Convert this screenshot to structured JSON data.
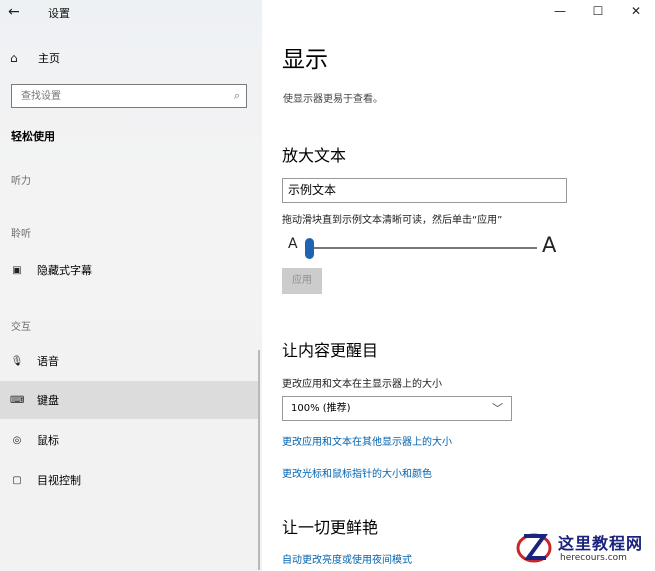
{
  "window": {
    "title": "设置",
    "back_glyph": "←",
    "minimize_glyph": "—",
    "maximize_glyph": "☐",
    "close_glyph": "✕"
  },
  "sidebar": {
    "home_label": "主页",
    "home_icon": "⌂",
    "search_placeholder": "查找设置",
    "search_icon": "⌕",
    "category_title": "轻松使用",
    "groups": {
      "hearing": "听力",
      "listening": "聆听",
      "interaction": "交互"
    },
    "items": [
      {
        "label": "隐藏式字幕",
        "icon": "▣",
        "selected": false
      },
      {
        "label": "语音",
        "icon": "🎙",
        "selected": false
      },
      {
        "label": "键盘",
        "icon": "⌨",
        "selected": true
      },
      {
        "label": "鼠标",
        "icon": "◎",
        "selected": false
      },
      {
        "label": "目视控制",
        "icon": "▢",
        "selected": false
      }
    ]
  },
  "main": {
    "title": "显示",
    "subtitle": "使显示器更易于查看。",
    "section_text": {
      "heading": "放大文本",
      "sample_text": "示例文本",
      "hint": "拖动滑块直到示例文本清晰可读，然后单击“应用”",
      "slider_min_label": "A",
      "slider_max_label": "A",
      "slider_value": 0,
      "apply_label": "应用"
    },
    "section_stand_out": {
      "heading": "让内容更醒目",
      "size_label": "更改应用和文本在主显示器上的大小",
      "size_value": "100% (推荐)",
      "size_chevron": "﹀",
      "link_other_displays": "更改应用和文本在其他显示器上的大小",
      "link_cursor": "更改光标和鼠标指针的大小和颜色"
    },
    "section_brighter": {
      "heading": "让一切更鲜艳",
      "link_brightness": "自动更改亮度或使用夜间模式"
    }
  },
  "watermark": {
    "cn": "这里教程网",
    "en": "herecours.com"
  },
  "colors": {
    "accent": "#1f64b4",
    "link": "#0063b1",
    "sidebar_bg": "#f2f2f2",
    "selected_bg": "#dcdcdc"
  }
}
